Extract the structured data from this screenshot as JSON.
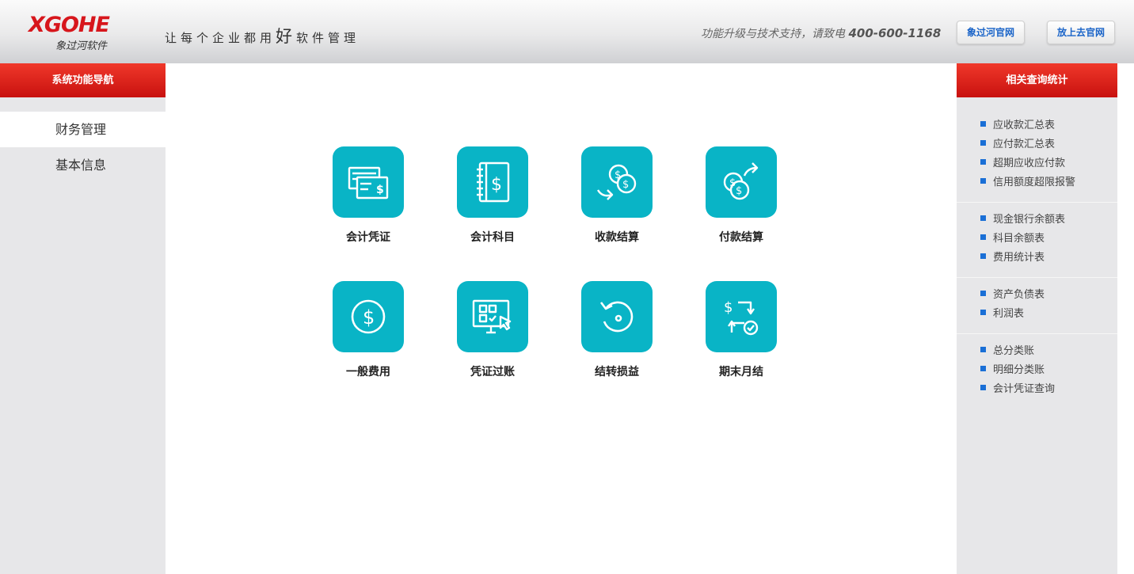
{
  "header": {
    "logo_text": "XGOHE",
    "logo_sub": "象过河软件",
    "slogan_pre": "让每个企业都用",
    "slogan_emph": "好",
    "slogan_post": "软件管理",
    "support_text": "功能升级与技术支持，请致电",
    "support_phone": "400-600-1168",
    "buttons": [
      "象过河官网",
      "放上去官网"
    ]
  },
  "left_nav": {
    "title": "系统功能导航",
    "items": [
      {
        "label": "财务管理",
        "active": true
      },
      {
        "label": "基本信息",
        "active": false
      }
    ]
  },
  "main": {
    "tiles": [
      {
        "label": "会计凭证",
        "icon": "voucher-bills-icon"
      },
      {
        "label": "会计科目",
        "icon": "ledger-book-icon"
      },
      {
        "label": "收款结算",
        "icon": "coins-receive-icon"
      },
      {
        "label": "付款结算",
        "icon": "coins-pay-icon"
      },
      {
        "label": "一般费用",
        "icon": "dollar-circle-icon"
      },
      {
        "label": "凭证过账",
        "icon": "monitor-posting-icon"
      },
      {
        "label": "结转损益",
        "icon": "rotate-transfer-icon"
      },
      {
        "label": "期末月结",
        "icon": "month-end-close-icon"
      }
    ],
    "tile_color": "#09b4c6"
  },
  "right_panel": {
    "title": "相关查询统计",
    "groups": [
      [
        "应收款汇总表",
        "应付款汇总表",
        "超期应收应付款",
        "信用额度超限报警"
      ],
      [
        "现金银行余额表",
        "科目余额表",
        "费用统计表"
      ],
      [
        "资产负债表",
        "利润表"
      ],
      [
        "总分类账",
        "明细分类账",
        "会计凭证查询"
      ]
    ]
  },
  "colors": {
    "brand_red": "#d7161c",
    "link_blue": "#1a64c8",
    "bullet_blue": "#1a6fd6"
  }
}
